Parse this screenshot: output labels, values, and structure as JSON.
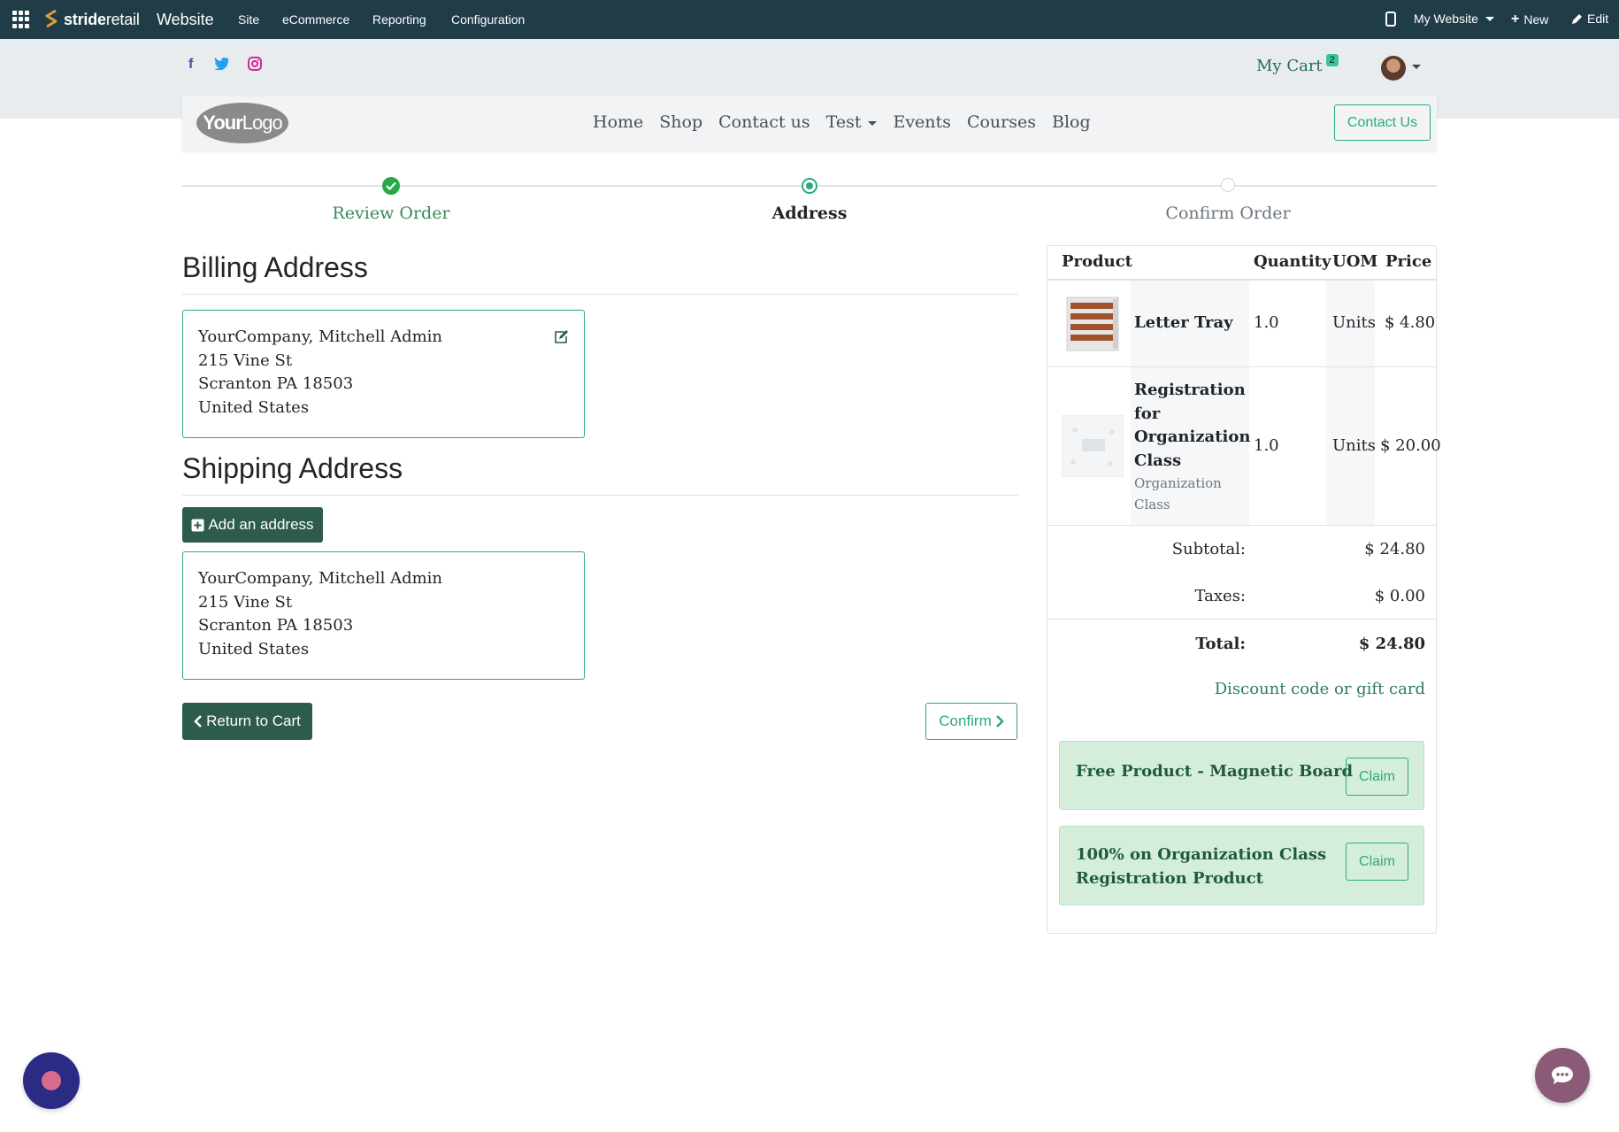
{
  "topbar": {
    "brand_bold": "stride",
    "brand_light": "retail",
    "module": "Website",
    "menu": [
      "Site",
      "eCommerce",
      "Reporting",
      "Configuration"
    ],
    "website_selector": "My Website",
    "new_label": "New",
    "edit_label": "Edit"
  },
  "header": {
    "social": [
      "facebook-icon",
      "twitter-icon",
      "instagram-icon"
    ],
    "cart_label": "My Cart",
    "cart_count": "2"
  },
  "navbar": {
    "logo_bold": "Your",
    "logo_light": "Logo",
    "links": [
      "Home",
      "Shop",
      "Contact us",
      "Test",
      "Events",
      "Courses",
      "Blog"
    ],
    "contact_button": "Contact Us"
  },
  "progress": {
    "steps": [
      "Review Order",
      "Address",
      "Confirm Order"
    ],
    "current": "Address"
  },
  "billing": {
    "heading": "Billing Address",
    "lines": [
      "YourCompany, Mitchell Admin",
      "215 Vine St",
      "Scranton PA 18503",
      "United States"
    ]
  },
  "shipping": {
    "heading": "Shipping Address",
    "add_button": "Add an address",
    "lines": [
      "YourCompany, Mitchell Admin",
      "215 Vine St",
      "Scranton PA 18503",
      "United States"
    ]
  },
  "actions": {
    "return_label": "Return to Cart",
    "confirm_label": "Confirm"
  },
  "summary": {
    "headers": [
      "Product",
      "Quantity",
      "UOM",
      "Price"
    ],
    "items": [
      {
        "name": "Letter Tray",
        "subtitle": "",
        "quantity": "1.0",
        "uom": "Units",
        "price": "$ 4.80"
      },
      {
        "name_lines": [
          "Registration",
          "for",
          "Organization",
          "Class"
        ],
        "subtitle_lines": [
          "Organization",
          "Class"
        ],
        "quantity": "1.0",
        "uom": "Units",
        "price": "$ 20.00"
      }
    ],
    "subtotal_label": "Subtotal:",
    "subtotal": "$ 24.80",
    "taxes_label": "Taxes:",
    "taxes": "$ 0.00",
    "total_label": "Total:",
    "total": "$ 24.80",
    "discount_link": "Discount code or gift card",
    "promos": [
      {
        "lines": [
          "Free Product - Magnetic Board"
        ],
        "button": "Claim"
      },
      {
        "lines": [
          "100% on Organization Class",
          "Registration Product"
        ],
        "button": "Claim"
      }
    ]
  },
  "colors": {
    "topbar": "#1f3c47",
    "accent": "#2ea981",
    "dark_button": "#2d5b4e",
    "promo_bg": "#d5eedc"
  }
}
